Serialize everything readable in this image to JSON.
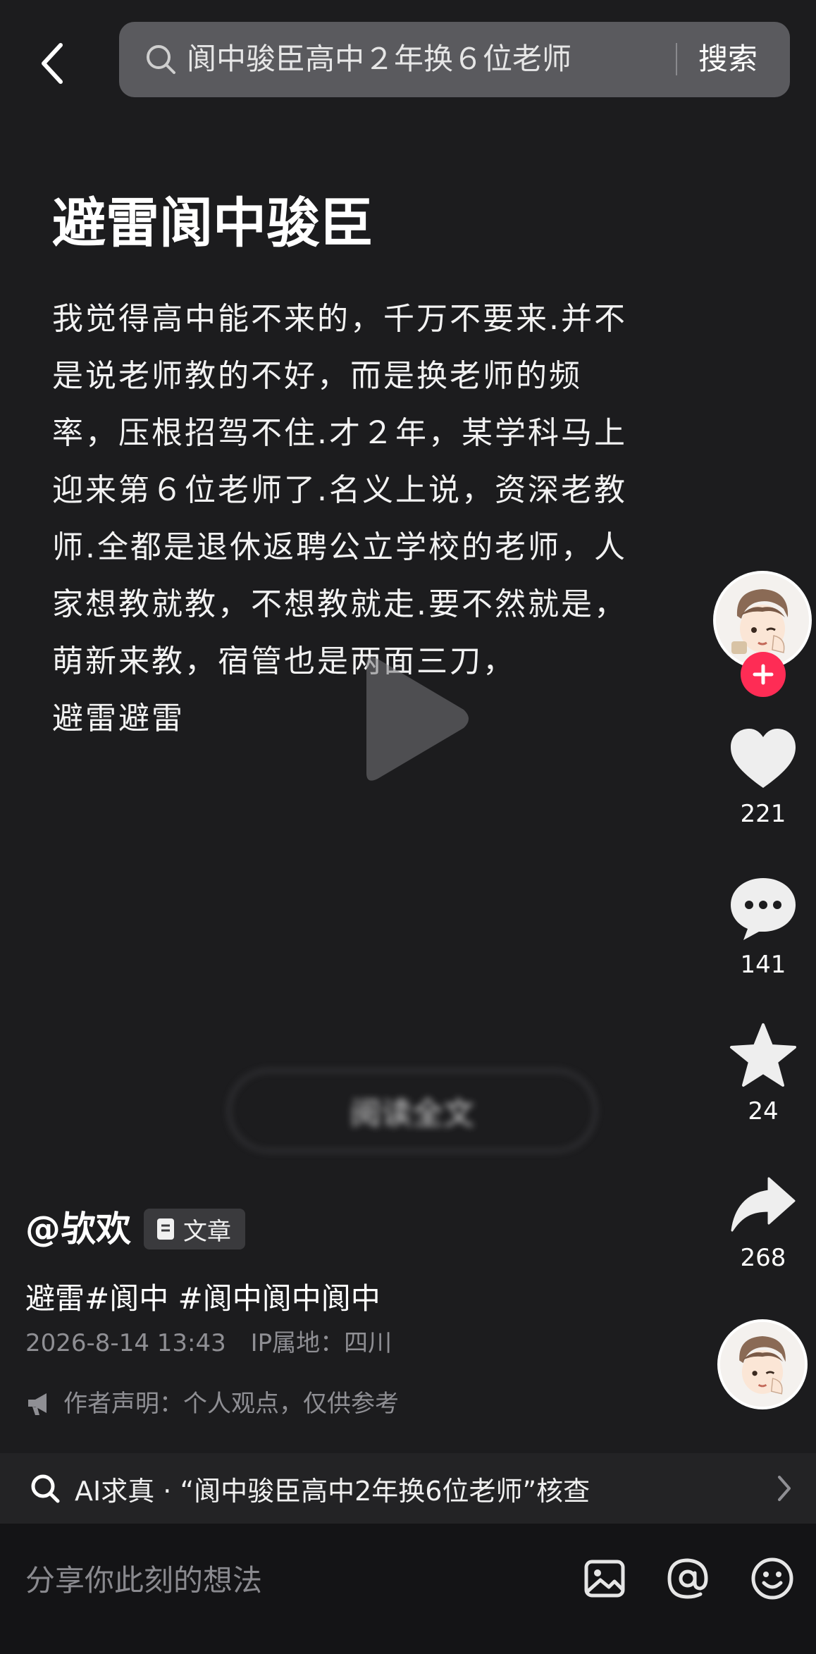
{
  "search": {
    "query": "阆中骏臣高中２年换６位老师",
    "button": "搜索"
  },
  "article": {
    "title": "避雷阆中骏臣",
    "body": "我觉得高中能不来的，千万不要来.并不\n是说老师教的不好，而是换老师的频\n率，压根招驾不住.才２年，某学科马上\n迎来第６位老师了.名义上说，资深老教\n师.全都是退休返聘公立学校的老师，人\n家想教就教，不想教就走.要不然就是，\n萌新来教，宿管也是两面三刀，\n避雷避雷",
    "read_full": "阅读全文"
  },
  "sidebar": {
    "likes": "221",
    "comments": "141",
    "favorites": "24",
    "shares": "268"
  },
  "post": {
    "author": "@欤欢",
    "type_badge": "文章",
    "tags": "避雷#阆中 #阆中阆中阆中",
    "date": "2026-8-14 13:43",
    "ip": "IP属地：四川",
    "notice": "作者声明：个人观点，仅供参考"
  },
  "ai_bar": {
    "text": "AI求真 · “阆中骏臣高中2年换6位老师”核查"
  },
  "bottom": {
    "comment_placeholder": "分享你此刻的想法"
  },
  "colors": {
    "accent_red": "#fe2c55",
    "background": "#1c1c1e"
  },
  "icons": [
    "back-icon",
    "search-icon",
    "play-icon",
    "heart-icon",
    "comment-icon",
    "star-icon",
    "share-icon",
    "document-icon",
    "megaphone-icon",
    "chevron-right-icon",
    "image-icon",
    "at-icon",
    "emoji-icon",
    "plus-icon"
  ]
}
